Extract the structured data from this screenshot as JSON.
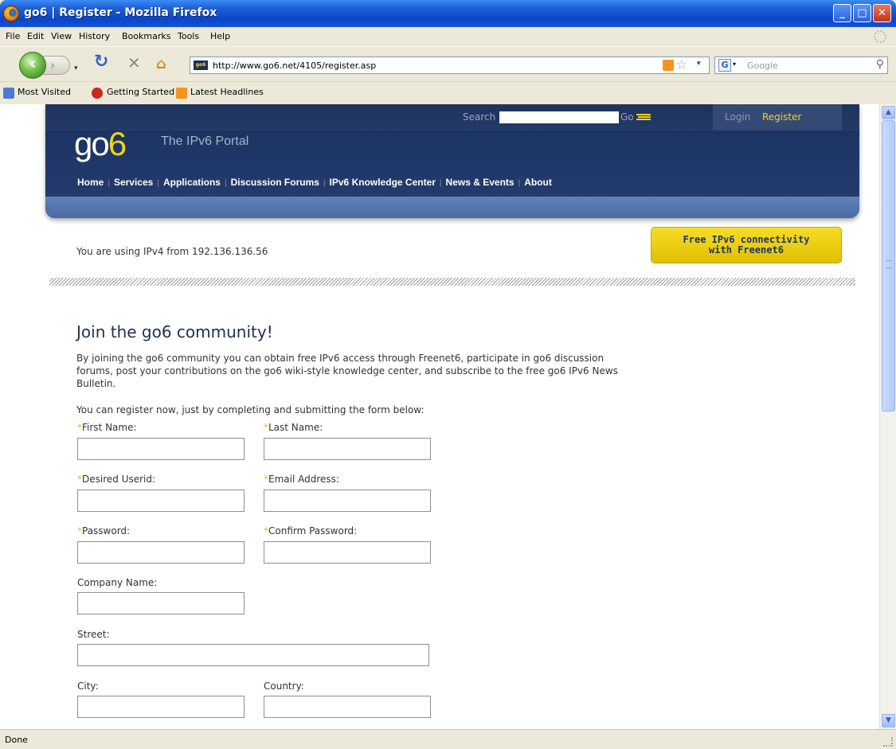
{
  "window": {
    "title": "go6 | Register - Mozilla Firefox"
  },
  "menu": [
    "File",
    "Edit",
    "View",
    "History",
    "Bookmarks",
    "Tools",
    "Help"
  ],
  "toolbar": {
    "url": "http://www.go6.net/4105/register.asp",
    "site_icon_text": "go6",
    "search_placeholder": "Google"
  },
  "bookmarks": [
    {
      "label": "Most Visited"
    },
    {
      "label": "Getting Started"
    },
    {
      "label": "Latest Headlines"
    }
  ],
  "site": {
    "logo_main": "go",
    "logo_six": "6",
    "tagline": "The IPv6 Portal",
    "search_label": "Search",
    "search_go": "Go",
    "login": "Login",
    "register": "Register",
    "nav": [
      "Home",
      "Services",
      "Applications",
      "Discussion Forums",
      "IPv6 Knowledge Center",
      "News & Events",
      "About"
    ]
  },
  "page": {
    "ip_info": "You are using IPv4 from 192.136.136.56",
    "promo_line1": "Free IPv6 connectivity",
    "promo_line2": "with Freenet6",
    "heading": "Join the go6 community!",
    "intro": "By joining the go6 community you can obtain free IPv6 access through Freenet6, participate in go6 discussion forums, post your contributions on the go6 wiki-style knowledge center, and subscribe to the free go6 IPv6 News Bulletin.",
    "intro2": "You can register now, just by completing and submitting the form below:"
  },
  "form": {
    "required_marker": "*",
    "first_name": "First Name:",
    "last_name": "Last Name:",
    "userid": "Desired Userid:",
    "email": "Email Address:",
    "password": "Password:",
    "confirm_password": "Confirm Password:",
    "company": "Company Name:",
    "street": "Street:",
    "city": "City:",
    "country": "Country:"
  },
  "status": {
    "text": "Done"
  },
  "colors": {
    "accent": "#f2d21a",
    "header": "#1d3564",
    "promo": "#f6dc28"
  }
}
